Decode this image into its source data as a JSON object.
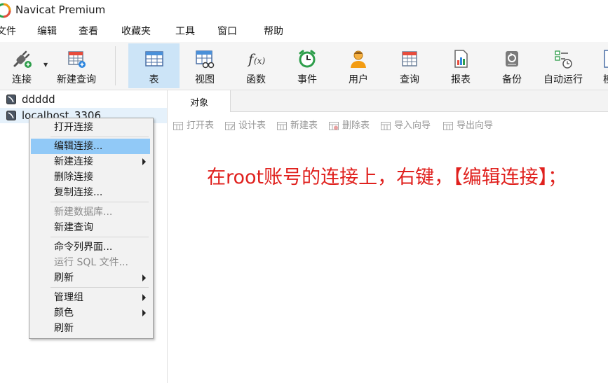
{
  "window": {
    "title": "Navicat Premium",
    "logo_icon": "navicat-logo-icon"
  },
  "menubar": [
    {
      "id": "file",
      "label": "文件"
    },
    {
      "id": "edit",
      "label": "编辑"
    },
    {
      "id": "view",
      "label": "查看"
    },
    {
      "id": "favorites",
      "label": "收藏夹"
    },
    {
      "id": "tools",
      "label": "工具"
    },
    {
      "id": "window",
      "label": "窗口"
    },
    {
      "id": "help",
      "label": "帮助"
    }
  ],
  "toolbar": {
    "connect": {
      "label": "连接",
      "icon": "plug-icon"
    },
    "new_query": {
      "label": "新建查询",
      "icon": "new-query-icon"
    },
    "table": {
      "label": "表",
      "icon": "table-icon"
    },
    "view": {
      "label": "视图",
      "icon": "view-icon"
    },
    "function": {
      "label": "函数",
      "icon": "function-icon"
    },
    "event": {
      "label": "事件",
      "icon": "alarm-clock-icon"
    },
    "user": {
      "label": "用户",
      "icon": "user-icon"
    },
    "query": {
      "label": "查询",
      "icon": "query-icon"
    },
    "report": {
      "label": "报表",
      "icon": "report-icon"
    },
    "backup": {
      "label": "备份",
      "icon": "backup-icon"
    },
    "automation": {
      "label": "自动运行",
      "icon": "checklist-clock-icon"
    },
    "model": {
      "label": "模",
      "icon": "model-icon"
    }
  },
  "connections": [
    {
      "name": "ddddd"
    },
    {
      "name": "localhost_3306"
    }
  ],
  "tabs": {
    "objects": "对象"
  },
  "object_toolbar": {
    "open_table": "打开表",
    "design_table": "设计表",
    "new_table": "新建表",
    "delete_table": "删除表",
    "import_wizard": "导入向导",
    "export_wizard": "导出向导"
  },
  "annotation": "在root账号的连接上，右键，【编辑连接】；",
  "context_menu": {
    "open_connection": "打开连接",
    "edit_connection": "编辑连接...",
    "new_connection": "新建连接",
    "delete_connection": "删除连接",
    "copy_connection": "复制连接...",
    "new_database": "新建数据库...",
    "new_query": "新建查询",
    "command_line": "命令列界面...",
    "run_sql_file": "运行 SQL 文件...",
    "refresh_1": "刷新",
    "manage_group": "管理组",
    "color": "颜色",
    "refresh_2": "刷新"
  },
  "colors": {
    "accent": "#91c9f7",
    "toolbar_active": "#cce4f7",
    "annotation": "#e0211e",
    "disabled_text": "#999999"
  }
}
